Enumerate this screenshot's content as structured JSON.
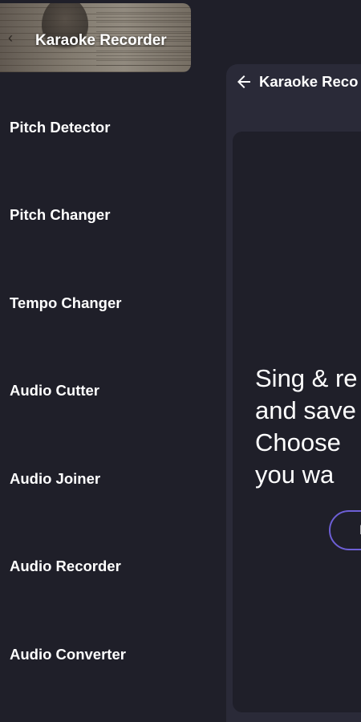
{
  "drawer": {
    "header_title": "Karaoke Recorder",
    "items": [
      {
        "label": "Pitch Detector"
      },
      {
        "label": "Pitch Changer"
      },
      {
        "label": "Tempo Changer"
      },
      {
        "label": "Audio Cutter"
      },
      {
        "label": "Audio Joiner"
      },
      {
        "label": "Audio Recorder"
      },
      {
        "label": "Audio Converter"
      }
    ]
  },
  "page": {
    "toolbar_title": "Karaoke Reco",
    "message_lines": [
      "Sing & re",
      "and save",
      "Choose",
      "you wa"
    ],
    "action_button_label": "B"
  },
  "colors": {
    "background": "#1f1f29",
    "panel": "#2a2a38",
    "accent": "#6d5fd6"
  },
  "icons": {
    "back": "arrow-left-icon"
  }
}
